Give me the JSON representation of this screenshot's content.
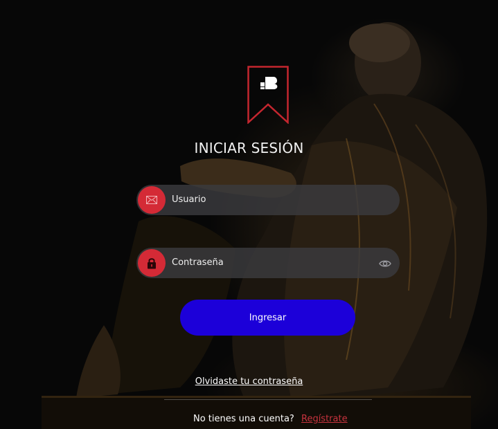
{
  "login": {
    "title": "INICIAR SESIÓN",
    "username_placeholder": "Usuario",
    "password_placeholder": "Contraseña",
    "submit_label": "Ingresar",
    "forgot_label": "Olvidaste tu contraseña",
    "signup_prompt": "No tienes una cuenta?",
    "signup_link": "Regístrate"
  },
  "icons": {
    "logo": "bookmark-logo",
    "username": "envelope-icon",
    "password": "lock-icon",
    "toggle": "eye-icon"
  },
  "colors": {
    "accent": "#d42a36",
    "primary_button": "#1c00d9",
    "link": "#c8333e",
    "background": "#070707"
  }
}
